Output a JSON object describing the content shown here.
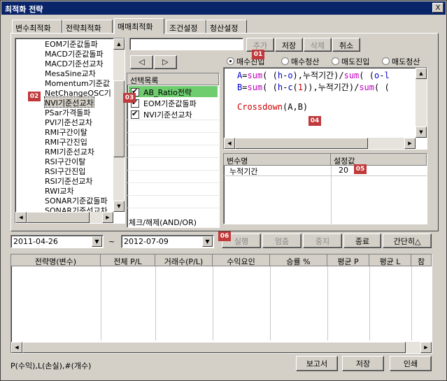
{
  "window": {
    "title": "최적화 전략",
    "close_label": "X"
  },
  "tabs": [
    "변수최적화",
    "전략최적화",
    "매매최적화",
    "조건설정",
    "청산설정"
  ],
  "indicator_list": [
    "EOM기준값돌파",
    "MACD기준값돌파",
    "MACD기준선교차",
    "MesaSine교차",
    "Momentum기준값",
    "NetChangeOSC기",
    "NVI기준선교차",
    "PSar가격돌파",
    "PVI기준선교차",
    "RMI구간이탈",
    "RMI구간진입",
    "RMI기준선교차",
    "RSI구간이탈",
    "RSI구간진입",
    "RSI기준선교차",
    "RWI교차",
    "SONAR기준값돌파",
    "SONAR기준선교차"
  ],
  "search": {
    "value": ""
  },
  "buttons": {
    "add": "추가",
    "save_top": "저장",
    "delete": "삭제",
    "cancel": "취소",
    "nav_left": "◁",
    "nav_right": "▷",
    "run": "실행",
    "pause": "멈춤",
    "stop": "중지",
    "close": "종료",
    "simple": "간단히△",
    "report": "보고서",
    "save_bottom": "저장",
    "print": "인쇄"
  },
  "radios": [
    "매수진입",
    "매수청산",
    "매도진입",
    "매도청산"
  ],
  "selection": {
    "header": "선택목록",
    "items": [
      "AB_Ratio전략",
      "EOM기준값돌파",
      "NVI기준선교차"
    ],
    "footer": "체크/해제(AND/OR)"
  },
  "code": {
    "line1": {
      "a": "A",
      "b": "=",
      "c": "sum",
      "d": "( (",
      "e": "h",
      "f": "-",
      "g": "o",
      "h": "),누적기간)/",
      "i": "sum",
      "j": "( (",
      "k": "o",
      "l": "-",
      "m": "l"
    },
    "line2": {
      "a": "B",
      "b": "=",
      "c": "sum",
      "d": "( (",
      "e": "h",
      "f": "-",
      "g": "c",
      "h": "(",
      "i": "1",
      "j": ")),누적기간)/",
      "k": "sum",
      "l": "( ("
    },
    "line3": {
      "a": "Crossdown",
      "b": "(A,B)"
    }
  },
  "variables": {
    "col_name": "변수명",
    "col_value": "설정값",
    "rows": [
      {
        "name": "누적기간",
        "value": "20"
      }
    ]
  },
  "dates": {
    "from": "2011-04-26",
    "sep": "~",
    "to": "2012-07-09"
  },
  "results": {
    "columns": [
      "전략명(변수)",
      "전체 P/L",
      "거래수(P/L)",
      "수익요인",
      "승률 %",
      "평균 P",
      "평균 L",
      "참"
    ]
  },
  "legend": "P(수익),L(손실),#(개수)",
  "badges": [
    "01",
    "02",
    "03",
    "04",
    "05",
    "06"
  ],
  "colors": {
    "title_bg": "#0a246a",
    "selected_row": "#6fcd6f",
    "badge": "#c0393b"
  }
}
